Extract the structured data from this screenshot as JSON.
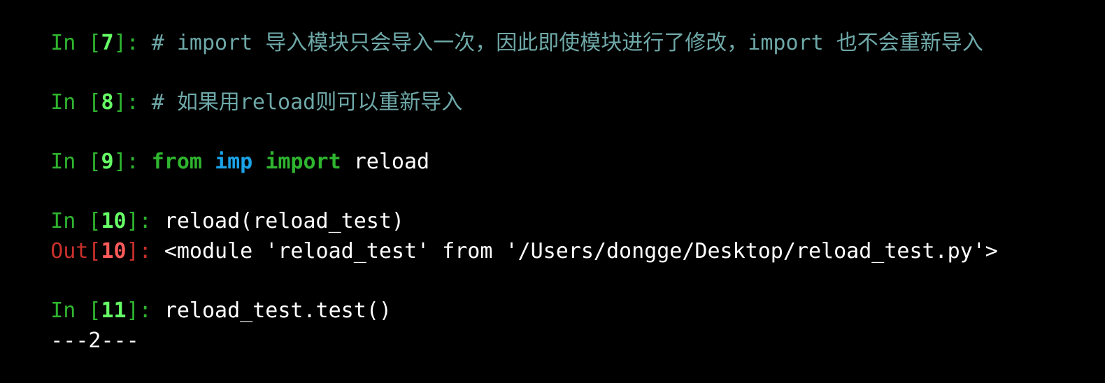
{
  "colors": {
    "background": "#000000",
    "prompt_in": "#2fb52f",
    "prompt_in_number": "#66ff66",
    "prompt_out": "#c9302c",
    "prompt_out_number": "#ff5a5a",
    "comment": "#6fa8a8",
    "keyword": "#2fb52f",
    "module_name": "#1aa3e8",
    "code": "#ffffff"
  },
  "cells": {
    "c7": {
      "in_label": "In [",
      "number": "7",
      "suffix": "]: ",
      "comment": "# import 导入模块只会导入一次，因此即使模块进行了修改，import 也不会重新导入"
    },
    "c8": {
      "in_label": "In [",
      "number": "8",
      "suffix": "]: ",
      "comment": "# 如果用reload则可以重新导入"
    },
    "c9": {
      "in_label": "In [",
      "number": "9",
      "suffix": "]: ",
      "kw_from": "from",
      "module": "imp",
      "kw_import": "import",
      "name": "reload"
    },
    "c10": {
      "in_label": "In [",
      "number": "10",
      "suffix": "]: ",
      "code": "reload(reload_test)",
      "out_label": "Out[",
      "out_number": "10",
      "out_suffix": "]: ",
      "output": "<module 'reload_test' from '/Users/dongge/Desktop/reload_test.py'>"
    },
    "c11": {
      "in_label": "In [",
      "number": "11",
      "suffix": "]: ",
      "code": "reload_test.test()",
      "stdout": "---2---"
    }
  }
}
